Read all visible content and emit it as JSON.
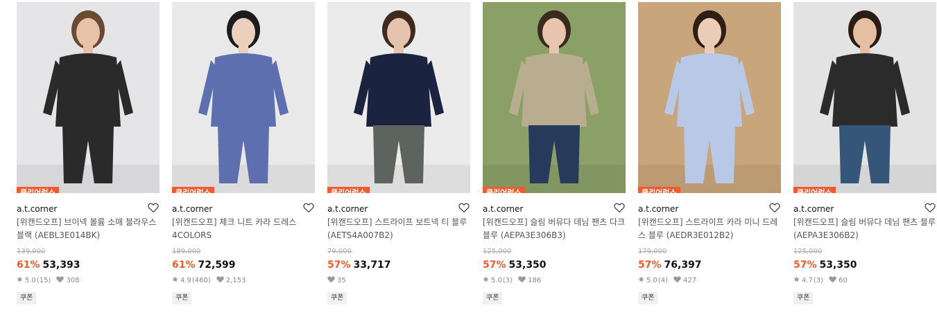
{
  "colors": {
    "accent": "#f05a2c",
    "original_price": "#aaaaaa"
  },
  "products": [
    {
      "badge": "클리어런스",
      "brand": "a.t.corner",
      "title": "[위캔드오프] 브이넥 볼륨 소매 블라우스 블랙 (AEBL3E014BK)",
      "original_price": "139,000",
      "discount": "61%",
      "price": "53,393",
      "rating": "5.0",
      "reviews": "(15)",
      "likes": "308",
      "coupon": "쿠폰",
      "photo": {
        "bg": "#e5e5e7",
        "outfit": "#2a2a2a",
        "bottom": "#2a2a2a",
        "hair": "#6b4a33",
        "skin": "#e8c2a8"
      }
    },
    {
      "badge": "클리어런스",
      "brand": "a.t.corner",
      "title": "[위캔드오프] 체크 니트 카라 드레스 4COLORS",
      "original_price": "189,000",
      "discount": "61%",
      "price": "72,599",
      "rating": "4.9",
      "reviews": "(460)",
      "likes": "2,153",
      "coupon": "쿠폰",
      "photo": {
        "bg": "#e9e9ea",
        "outfit": "#5e6fb0",
        "bottom": "#5e6fb0",
        "hair": "#1c1c1c",
        "skin": "#ead0bd"
      }
    },
    {
      "badge": "클리어런스",
      "brand": "a.t.corner",
      "title": "[위캔드오프] 스트라이프 보트넥 티 블루 (AETS4A007B2)",
      "original_price": "79,000",
      "discount": "57%",
      "price": "33,717",
      "rating": "",
      "reviews": "",
      "likes": "35",
      "coupon": "쿠폰",
      "photo": {
        "bg": "#ebebeb",
        "outfit": "#1a2340",
        "bottom": "#5d635e",
        "hair": "#3d2b1f",
        "skin": "#e5c3ac"
      }
    },
    {
      "badge": "클리어런스",
      "brand": "a.t.corner",
      "title": "[위캔드오프] 슬림 버뮤다 데님 팬츠 다크블루 (AEPA3E306B3)",
      "original_price": "125,000",
      "discount": "57%",
      "price": "53,350",
      "rating": "5.0",
      "reviews": "(3)",
      "likes": "186",
      "coupon": "쿠폰",
      "photo": {
        "bg": "#8aa066",
        "outfit": "#b9ad90",
        "bottom": "#283a5c",
        "hair": "#3a2a20",
        "skin": "#e8c6ae"
      }
    },
    {
      "badge": "클리어런스",
      "brand": "a.t.corner",
      "title": "[위캔드오프] 스트라이프 카라 미니 드레스 블루 (AEDR3E012B2)",
      "original_price": "179,000",
      "discount": "57%",
      "price": "76,397",
      "rating": "5.0",
      "reviews": "(4)",
      "likes": "427",
      "coupon": "쿠폰",
      "photo": {
        "bg": "#c8a57a",
        "outfit": "#b7c9e6",
        "bottom": "#b7c9e6",
        "hair": "#2d1e16",
        "skin": "#ebcdb7"
      }
    },
    {
      "badge": "클리어런스",
      "brand": "a.t.corner",
      "title": "[위캔드오프] 슬림 버뮤다 데님 팬츠 블루 (AEPA3E306B2)",
      "original_price": "125,000",
      "discount": "57%",
      "price": "53,350",
      "rating": "4.7",
      "reviews": "(3)",
      "likes": "60",
      "coupon": "쿠폰",
      "photo": {
        "bg": "#e3e3e3",
        "outfit": "#2b2b2b",
        "bottom": "#355579",
        "hair": "#2a1d15",
        "skin": "#e6bea2"
      }
    }
  ]
}
